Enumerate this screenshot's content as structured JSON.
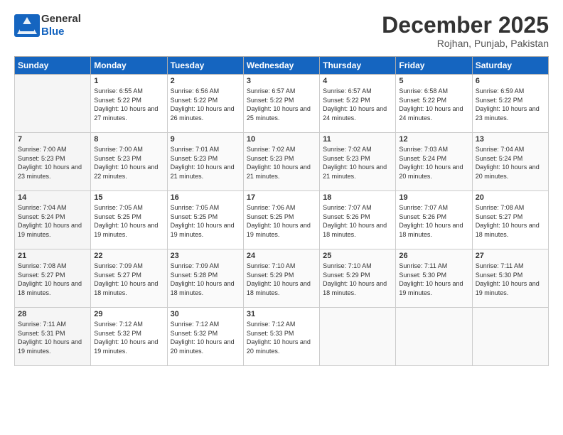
{
  "logo": {
    "line1": "General",
    "line2": "Blue"
  },
  "title": "December 2025",
  "location": "Rojhan, Punjab, Pakistan",
  "headers": [
    "Sunday",
    "Monday",
    "Tuesday",
    "Wednesday",
    "Thursday",
    "Friday",
    "Saturday"
  ],
  "weeks": [
    [
      {
        "day": "",
        "sunrise": "",
        "sunset": "",
        "daylight": ""
      },
      {
        "day": "1",
        "sunrise": "Sunrise: 6:55 AM",
        "sunset": "Sunset: 5:22 PM",
        "daylight": "Daylight: 10 hours and 27 minutes."
      },
      {
        "day": "2",
        "sunrise": "Sunrise: 6:56 AM",
        "sunset": "Sunset: 5:22 PM",
        "daylight": "Daylight: 10 hours and 26 minutes."
      },
      {
        "day": "3",
        "sunrise": "Sunrise: 6:57 AM",
        "sunset": "Sunset: 5:22 PM",
        "daylight": "Daylight: 10 hours and 25 minutes."
      },
      {
        "day": "4",
        "sunrise": "Sunrise: 6:57 AM",
        "sunset": "Sunset: 5:22 PM",
        "daylight": "Daylight: 10 hours and 24 minutes."
      },
      {
        "day": "5",
        "sunrise": "Sunrise: 6:58 AM",
        "sunset": "Sunset: 5:22 PM",
        "daylight": "Daylight: 10 hours and 24 minutes."
      },
      {
        "day": "6",
        "sunrise": "Sunrise: 6:59 AM",
        "sunset": "Sunset: 5:22 PM",
        "daylight": "Daylight: 10 hours and 23 minutes."
      }
    ],
    [
      {
        "day": "7",
        "sunrise": "Sunrise: 7:00 AM",
        "sunset": "Sunset: 5:23 PM",
        "daylight": "Daylight: 10 hours and 23 minutes."
      },
      {
        "day": "8",
        "sunrise": "Sunrise: 7:00 AM",
        "sunset": "Sunset: 5:23 PM",
        "daylight": "Daylight: 10 hours and 22 minutes."
      },
      {
        "day": "9",
        "sunrise": "Sunrise: 7:01 AM",
        "sunset": "Sunset: 5:23 PM",
        "daylight": "Daylight: 10 hours and 21 minutes."
      },
      {
        "day": "10",
        "sunrise": "Sunrise: 7:02 AM",
        "sunset": "Sunset: 5:23 PM",
        "daylight": "Daylight: 10 hours and 21 minutes."
      },
      {
        "day": "11",
        "sunrise": "Sunrise: 7:02 AM",
        "sunset": "Sunset: 5:23 PM",
        "daylight": "Daylight: 10 hours and 21 minutes."
      },
      {
        "day": "12",
        "sunrise": "Sunrise: 7:03 AM",
        "sunset": "Sunset: 5:24 PM",
        "daylight": "Daylight: 10 hours and 20 minutes."
      },
      {
        "day": "13",
        "sunrise": "Sunrise: 7:04 AM",
        "sunset": "Sunset: 5:24 PM",
        "daylight": "Daylight: 10 hours and 20 minutes."
      }
    ],
    [
      {
        "day": "14",
        "sunrise": "Sunrise: 7:04 AM",
        "sunset": "Sunset: 5:24 PM",
        "daylight": "Daylight: 10 hours and 19 minutes."
      },
      {
        "day": "15",
        "sunrise": "Sunrise: 7:05 AM",
        "sunset": "Sunset: 5:25 PM",
        "daylight": "Daylight: 10 hours and 19 minutes."
      },
      {
        "day": "16",
        "sunrise": "Sunrise: 7:05 AM",
        "sunset": "Sunset: 5:25 PM",
        "daylight": "Daylight: 10 hours and 19 minutes."
      },
      {
        "day": "17",
        "sunrise": "Sunrise: 7:06 AM",
        "sunset": "Sunset: 5:25 PM",
        "daylight": "Daylight: 10 hours and 19 minutes."
      },
      {
        "day": "18",
        "sunrise": "Sunrise: 7:07 AM",
        "sunset": "Sunset: 5:26 PM",
        "daylight": "Daylight: 10 hours and 18 minutes."
      },
      {
        "day": "19",
        "sunrise": "Sunrise: 7:07 AM",
        "sunset": "Sunset: 5:26 PM",
        "daylight": "Daylight: 10 hours and 18 minutes."
      },
      {
        "day": "20",
        "sunrise": "Sunrise: 7:08 AM",
        "sunset": "Sunset: 5:27 PM",
        "daylight": "Daylight: 10 hours and 18 minutes."
      }
    ],
    [
      {
        "day": "21",
        "sunrise": "Sunrise: 7:08 AM",
        "sunset": "Sunset: 5:27 PM",
        "daylight": "Daylight: 10 hours and 18 minutes."
      },
      {
        "day": "22",
        "sunrise": "Sunrise: 7:09 AM",
        "sunset": "Sunset: 5:27 PM",
        "daylight": "Daylight: 10 hours and 18 minutes."
      },
      {
        "day": "23",
        "sunrise": "Sunrise: 7:09 AM",
        "sunset": "Sunset: 5:28 PM",
        "daylight": "Daylight: 10 hours and 18 minutes."
      },
      {
        "day": "24",
        "sunrise": "Sunrise: 7:10 AM",
        "sunset": "Sunset: 5:29 PM",
        "daylight": "Daylight: 10 hours and 18 minutes."
      },
      {
        "day": "25",
        "sunrise": "Sunrise: 7:10 AM",
        "sunset": "Sunset: 5:29 PM",
        "daylight": "Daylight: 10 hours and 18 minutes."
      },
      {
        "day": "26",
        "sunrise": "Sunrise: 7:11 AM",
        "sunset": "Sunset: 5:30 PM",
        "daylight": "Daylight: 10 hours and 19 minutes."
      },
      {
        "day": "27",
        "sunrise": "Sunrise: 7:11 AM",
        "sunset": "Sunset: 5:30 PM",
        "daylight": "Daylight: 10 hours and 19 minutes."
      }
    ],
    [
      {
        "day": "28",
        "sunrise": "Sunrise: 7:11 AM",
        "sunset": "Sunset: 5:31 PM",
        "daylight": "Daylight: 10 hours and 19 minutes."
      },
      {
        "day": "29",
        "sunrise": "Sunrise: 7:12 AM",
        "sunset": "Sunset: 5:32 PM",
        "daylight": "Daylight: 10 hours and 19 minutes."
      },
      {
        "day": "30",
        "sunrise": "Sunrise: 7:12 AM",
        "sunset": "Sunset: 5:32 PM",
        "daylight": "Daylight: 10 hours and 20 minutes."
      },
      {
        "day": "31",
        "sunrise": "Sunrise: 7:12 AM",
        "sunset": "Sunset: 5:33 PM",
        "daylight": "Daylight: 10 hours and 20 minutes."
      },
      {
        "day": "",
        "sunrise": "",
        "sunset": "",
        "daylight": ""
      },
      {
        "day": "",
        "sunrise": "",
        "sunset": "",
        "daylight": ""
      },
      {
        "day": "",
        "sunrise": "",
        "sunset": "",
        "daylight": ""
      }
    ]
  ]
}
